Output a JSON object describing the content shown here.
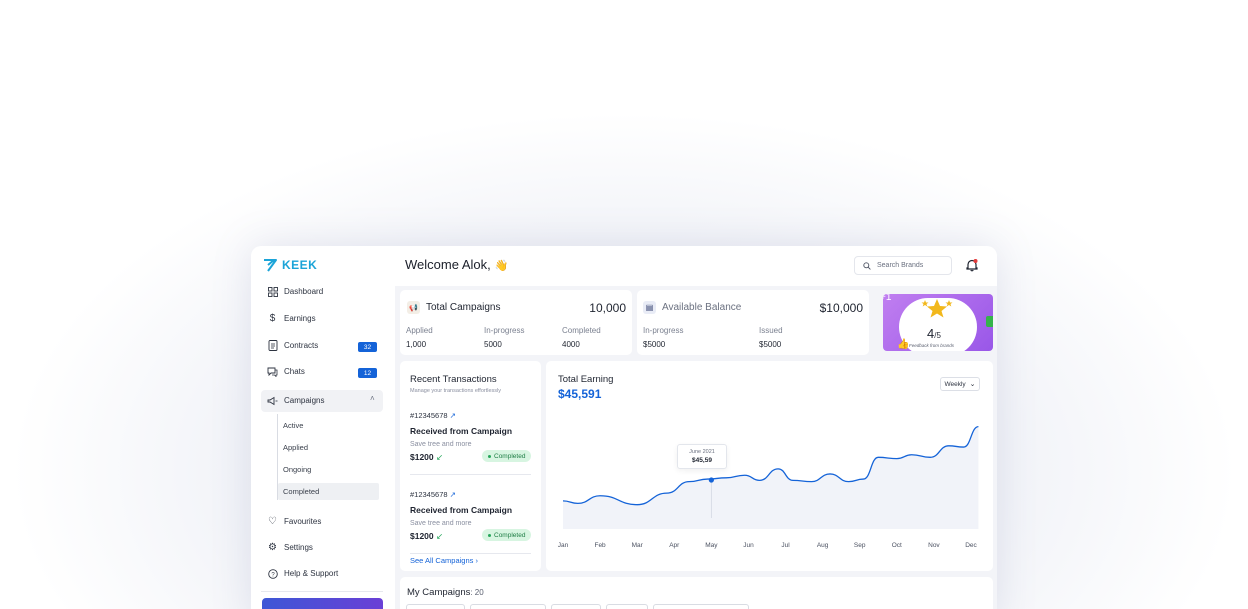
{
  "brand": {
    "name": "KEEK",
    "color": "#1ba4d8"
  },
  "sidebar": {
    "items": [
      {
        "label": "Dashboard",
        "icon": "grid-icon"
      },
      {
        "label": "Earnings",
        "icon": "dollar-icon"
      },
      {
        "label": "Contracts",
        "icon": "document-icon",
        "badge": "32"
      },
      {
        "label": "Chats",
        "icon": "chat-icon",
        "badge": "12"
      },
      {
        "label": "Campaigns",
        "icon": "megaphone-icon"
      },
      {
        "label": "Favourites",
        "icon": "heart-icon"
      },
      {
        "label": "Settings",
        "icon": "gear-icon"
      },
      {
        "label": "Help & Support",
        "icon": "help-icon"
      }
    ],
    "campaign_sub": [
      "Active",
      "Applied",
      "Ongoing",
      "Completed"
    ],
    "active_sub": "Completed"
  },
  "header": {
    "welcome": "Welcome Alok,",
    "search_placeholder": "Search Brands"
  },
  "campaigns_card": {
    "title": "Total Campaigns",
    "total": "10,000",
    "stats": [
      {
        "label": "Applied",
        "value": "1,000"
      },
      {
        "label": "In-progress",
        "value": "5000"
      },
      {
        "label": "Completed",
        "value": "4000"
      }
    ]
  },
  "balance_card": {
    "title": "Available Balance",
    "total": "$10,000",
    "stats": [
      {
        "label": "In-progress",
        "value": "$5000"
      },
      {
        "label": "Issued",
        "value": "$5000"
      }
    ]
  },
  "rating": {
    "score": "4",
    "out_of": "/5",
    "caption": "Feedback from brands",
    "accent": "#a463ec"
  },
  "transactions": {
    "title": "Recent Transactions",
    "subtitle": "Manage your transactions effortlessly",
    "items": [
      {
        "id": "#12345678",
        "name": "Received from Campaign",
        "note": "Save tree and more",
        "amount": "$1200",
        "status": "Completed"
      },
      {
        "id": "#12345678",
        "name": "Received from Campaign",
        "note": "Save tree and more",
        "amount": "$1200",
        "status": "Completed"
      }
    ],
    "see_all": "See All Campaigns"
  },
  "earning": {
    "title": "Total Earning",
    "value": "$45,591",
    "period": "Weekly",
    "tooltip": {
      "date": "June 2021",
      "value": "$45,59"
    }
  },
  "chart_data": {
    "type": "area",
    "categories": [
      "Jan",
      "Feb",
      "Mar",
      "Apr",
      "May",
      "Jun",
      "Jul",
      "Aug",
      "Sep",
      "Oct",
      "Nov",
      "Dec"
    ],
    "values": [
      22,
      20,
      26,
      19,
      28,
      37,
      39,
      40,
      42,
      38,
      47,
      38,
      37,
      43,
      37,
      39,
      56,
      55,
      58,
      56,
      65,
      64,
      80
    ],
    "x": [
      0,
      0.4,
      1,
      2,
      2.8,
      3.4,
      3.9,
      4.4,
      4.9,
      5.3,
      5.8,
      6.2,
      6.7,
      7.2,
      7.7,
      8.1,
      8.5,
      9,
      9.4,
      9.9,
      10.4,
      10.8,
      11.2
    ],
    "xlabel": "",
    "ylabel": "",
    "highlight": {
      "category": "May",
      "label": "June 2021",
      "value": "$45,59"
    },
    "ylim": [
      0,
      100
    ],
    "line_color": "#1463d8",
    "fill_color": "#f1f3f9",
    "grid": false
  },
  "my_campaigns": {
    "label": "My Campaigns",
    "count": ": 20"
  }
}
